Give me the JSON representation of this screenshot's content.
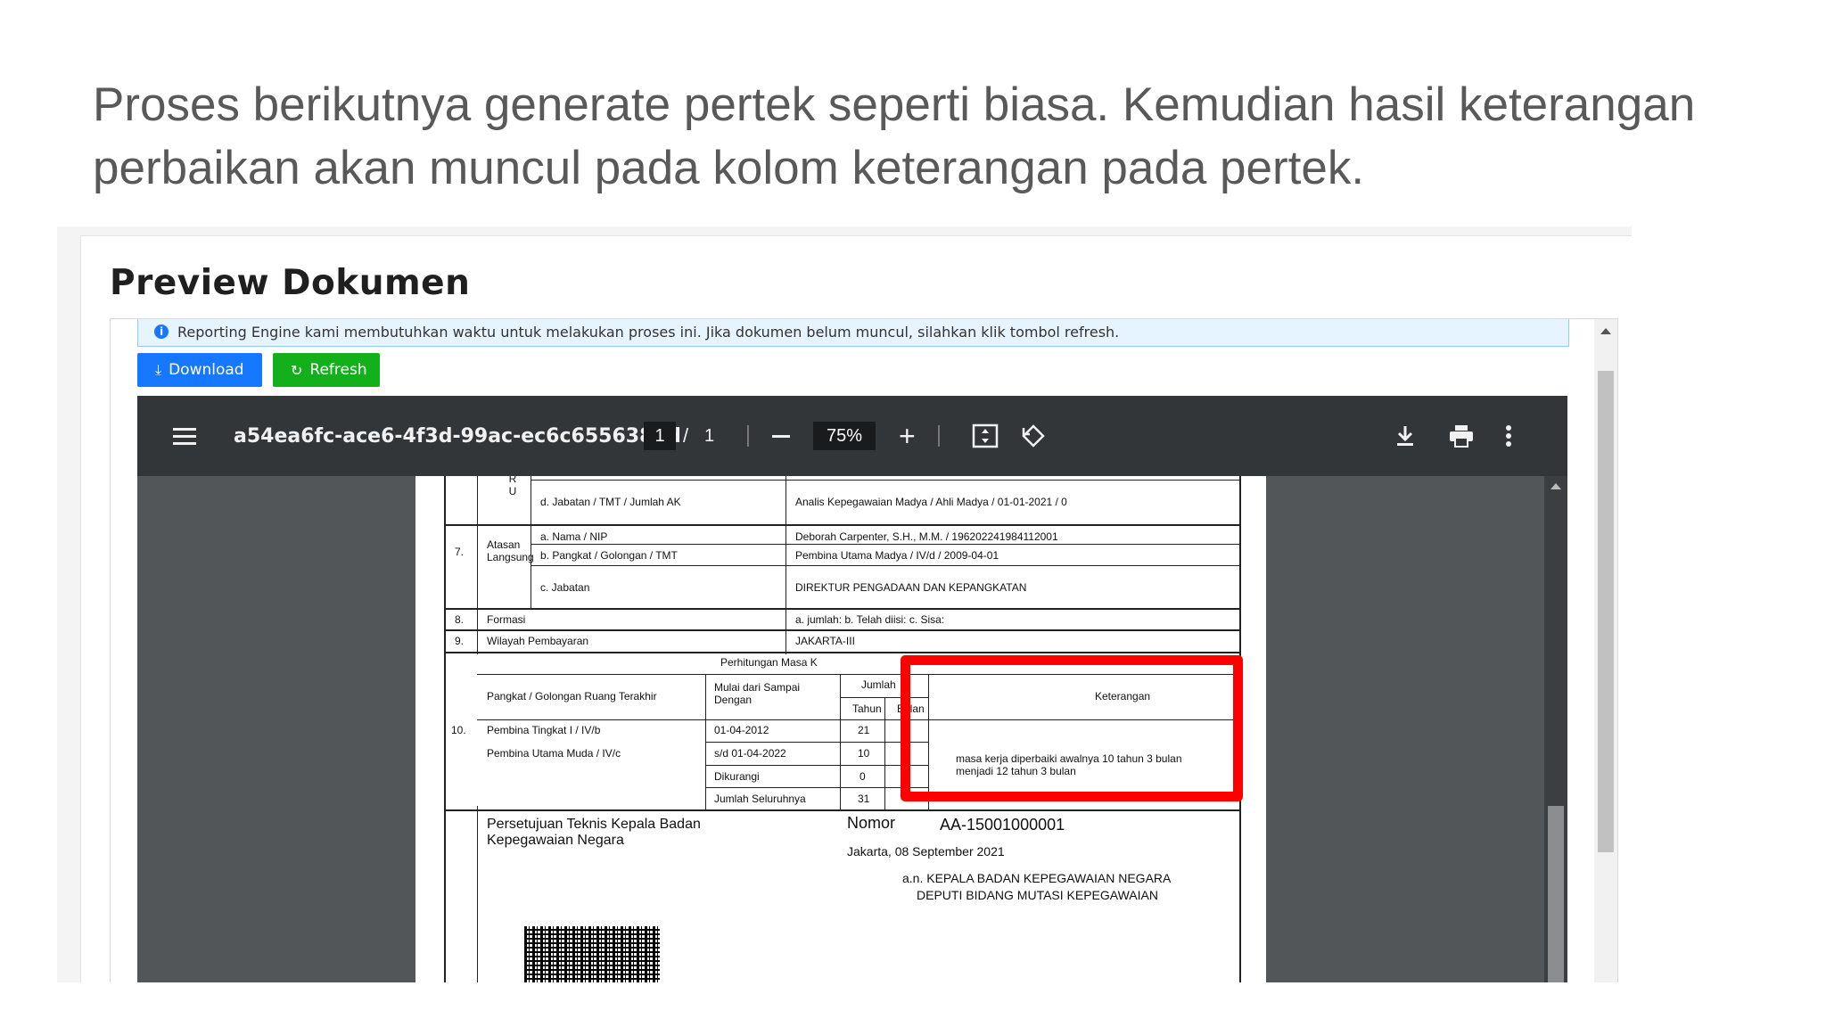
{
  "slide": {
    "heading": "Proses berikutnya generate pertek seperti biasa. Kemudian hasil keterangan perbaikan akan muncul pada kolom keterangan pada pertek."
  },
  "card": {
    "title": "Preview Dokumen",
    "alert_text": "Reporting Engine kami membutuhkan waktu untuk melakukan proses ini. Jika dokumen belum muncul, silahkan klik tombol refresh.",
    "buttons": {
      "download": "Download",
      "refresh": "Refresh"
    }
  },
  "viewer": {
    "doc_name": "a54ea6fc-ace6-4f3d-99ac-ec6c655638bd",
    "page_current": "1",
    "page_separator": "/",
    "page_total": "1",
    "zoom": "75%"
  },
  "document": {
    "row_top": {
      "fragment": "R U",
      "field": "d. Jabatan / TMT / Jumlah AK",
      "value": "Analis Kepegawaian Madya / Ahli Madya / 01-01-2021 / 0"
    },
    "row7": {
      "num": "7.",
      "label": "Atasan Langsung",
      "fields": [
        "a. Nama / NIP",
        "b. Pangkat / Golongan / TMT",
        "c. Jabatan"
      ],
      "values": [
        "Deborah Carpenter, S.H., M.M. / 196202241984112001",
        "Pembina Utama Madya / IV/d / 2009-04-01",
        "DIREKTUR PENGADAAN DAN KEPANGKATAN"
      ]
    },
    "row8": {
      "num": "8.",
      "label": "Formasi",
      "value": "a. jumlah:  b. Telah diisi:  c. Sisa:"
    },
    "row9": {
      "num": "9.",
      "label": "Wilayah Pembayaran",
      "value": "JAKARTA-III"
    },
    "row10": {
      "num": "10.",
      "section_title": "Perhitungan Masa K",
      "headers": {
        "pangkat": "Pangkat / Golongan Ruang Terakhir",
        "mulai": "Mulai dari Sampai Dengan",
        "jumlah": "Jumlah",
        "tahun": "Tahun",
        "bulan": "Bulan",
        "keterangan": "Keterangan"
      },
      "rows": [
        {
          "pangkat": "Pembina Tingkat I / IV/b",
          "tanggal": "01-04-2012",
          "tahun": "21"
        },
        {
          "pangkat": "Pembina Utama Muda / IV/c",
          "tanggal": "s/d   01-04-2022",
          "tahun": "10"
        },
        {
          "pangkat": "",
          "tanggal": "Dikurangi",
          "tahun": "0"
        },
        {
          "pangkat": "",
          "tanggal": "Jumlah Seluruhnya",
          "tahun": "31"
        }
      ],
      "keterangan_text": "masa kerja diperbaiki awalnya 10 tahun 3 bulan menjadi 12 tahun 3 bulan"
    },
    "approval": {
      "title": "Persetujuan Teknis Kepala Badan Kepegawaian Negara",
      "nomor_label": "Nomor",
      "nomor_value": "AA-15001000001",
      "place_date": "Jakarta, 08 September 2021",
      "signer_line1": "a.n. KEPALA BADAN KEPEGAWAIAN NEGARA",
      "signer_line2": "DEPUTI BIDANG MUTASI KEPEGAWAIAN"
    }
  },
  "colors": {
    "highlight": "#ff0000",
    "download_button": "#1677ff",
    "refresh_button": "#13b01b",
    "toolbar": "#323639"
  },
  "icons": [
    "info-icon",
    "download-icon",
    "refresh-icon",
    "menu-icon",
    "minus-icon",
    "plus-icon",
    "fit-page-icon",
    "rotate-icon",
    "download-icon",
    "print-icon",
    "more-icon"
  ]
}
